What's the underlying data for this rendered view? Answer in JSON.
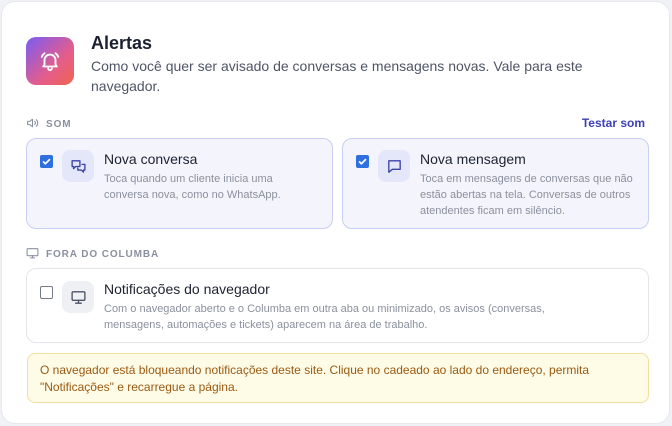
{
  "header": {
    "title": "Alertas",
    "description": "Como você quer ser avisado de conversas e mensagens novas. Vale para este navegador.",
    "icon": "bell-icon"
  },
  "sound_section": {
    "label": "SOM",
    "icon": "speaker-icon",
    "test_label": "Testar som",
    "options": [
      {
        "title": "Nova conversa",
        "description": "Toca quando um cliente inicia uma conversa nova, como no WhatsApp.",
        "checked": true,
        "icon": "chat-bubbles-icon"
      },
      {
        "title": "Nova mensagem",
        "description": "Toca em mensagens de conversas que não estão abertas na tela. Conversas de outros atendentes ficam em silêncio.",
        "checked": true,
        "icon": "message-square-icon"
      }
    ]
  },
  "outside_section": {
    "label": "FORA DO COLUMBA",
    "icon": "monitor-icon",
    "option": {
      "title": "Notificações do navegador",
      "description": "Com o navegador aberto e o Columba em outra aba ou minimizado, os avisos (conversas, mensagens, automações e tickets) aparecem na área de trabalho.",
      "checked": false,
      "icon": "monitor-icon"
    }
  },
  "warning": {
    "text": "O navegador está bloqueando notificações deste site. Clique no cadeado ao lado do endereço, permita \"Notificações\" e recarregue a página."
  },
  "colors": {
    "accent": "#3d3fb5",
    "checkbox": "#2f6fe0",
    "warning_bg": "#fefbe6",
    "warning_text": "#9a5a12"
  }
}
